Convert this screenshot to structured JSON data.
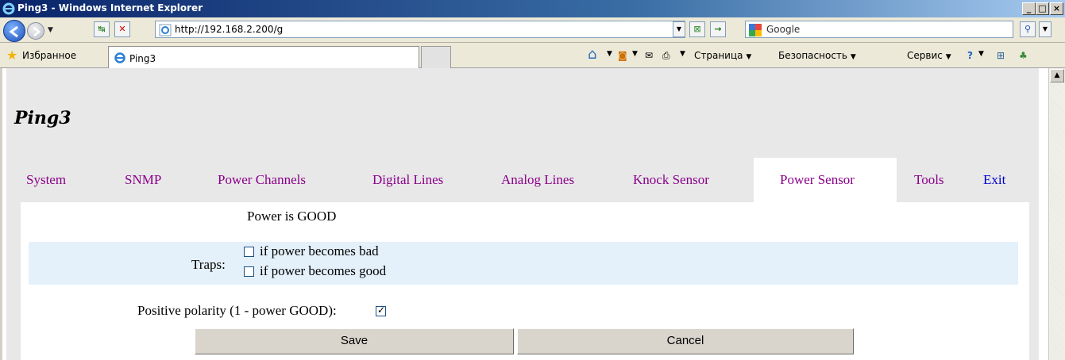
{
  "window": {
    "title": "Ping3 - Windows Internet Explorer",
    "controls": {
      "minimize": "_",
      "maximize": "□",
      "close": "×"
    }
  },
  "address_bar": {
    "url_prefix": "http://",
    "url_host": "192.168.2.200",
    "url_path": "/g",
    "search_placeholder": "Google"
  },
  "favorites_bar": {
    "favorites_label": "Избранное",
    "tab_title": "Ping3",
    "commands": {
      "page": "Страница",
      "safety": "Безопасность",
      "tools": "Сервис"
    }
  },
  "page": {
    "title": "Ping3",
    "nav": [
      {
        "label": "System"
      },
      {
        "label": "SNMP"
      },
      {
        "label": "Power Channels"
      },
      {
        "label": "Digital Lines"
      },
      {
        "label": "Analog Lines"
      },
      {
        "label": "Knock Sensor"
      },
      {
        "label": "Power Sensor",
        "active": true
      },
      {
        "label": "Tools"
      },
      {
        "label": "Exit"
      }
    ],
    "status": "Power is GOOD",
    "traps": {
      "label": "Traps:",
      "options": [
        {
          "label": "if power becomes bad",
          "checked": false
        },
        {
          "label": "if power becomes good",
          "checked": false
        }
      ]
    },
    "polarity": {
      "label": "Positive polarity (1 - power GOOD):",
      "checked": true
    },
    "buttons": {
      "save": "Save",
      "cancel": "Cancel"
    }
  },
  "colors": {
    "nav_link": "#8b008b",
    "exit_link": "#0000cc",
    "traps_band": "#e4f0fa",
    "page_bg": "#e8e8e8"
  }
}
